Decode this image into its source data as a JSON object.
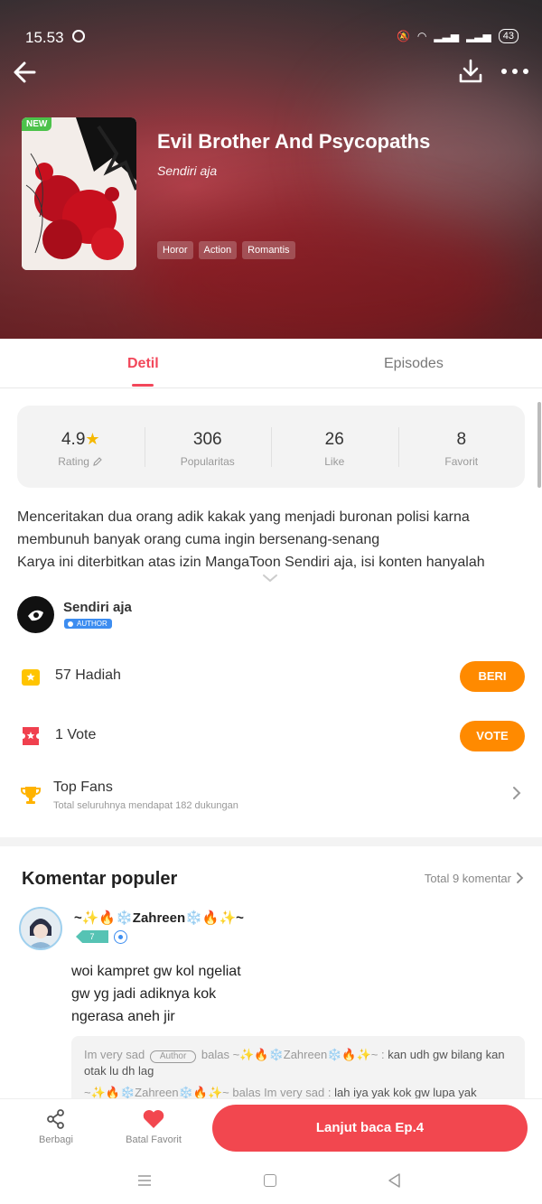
{
  "status_bar": {
    "time": "15.53",
    "battery": "43"
  },
  "manga": {
    "new_badge": "NEW",
    "title": "Evil Brother And Psycopaths",
    "author": "Sendiri aja",
    "tags": [
      "Horor",
      "Action",
      "Romantis"
    ]
  },
  "tabs": {
    "detail": "Detil",
    "episodes": "Episodes"
  },
  "stats": [
    {
      "value": "4.9",
      "label": "Rating"
    },
    {
      "value": "306",
      "label": "Popularitas"
    },
    {
      "value": "26",
      "label": "Like"
    },
    {
      "value": "8",
      "label": "Favorit"
    }
  ],
  "description": [
    "Menceritakan dua orang adik kakak yang menjadi buronan polisi karna",
    "membunuh banyak orang cuma ingin bersenang-senang",
    "Karya ini diterbitkan atas izin MangaToon Sendiri aja, isi konten hanyalah"
  ],
  "author_section": {
    "name": "Sendiri aja",
    "badge": "AUTHOR"
  },
  "gifts": {
    "label": "57 Hadiah",
    "button": "BERI"
  },
  "votes": {
    "label": "1 Vote",
    "button": "VOTE"
  },
  "top_fans": {
    "label": "Top Fans",
    "subtitle": "Total seluruhnya mendapat 182 dukungan"
  },
  "comments": {
    "title": "Komentar populer",
    "total": "Total 9 komentar",
    "items": [
      {
        "user": "~✨🔥❄️Zahreen❄️🔥✨~",
        "level": "7",
        "lines": [
          "woi kampret gw kol ngeliat",
          "gw yg jadi adiknya kok",
          "ngerasa aneh jir"
        ],
        "replies": [
          {
            "from": "Im very sad",
            "tag": "Author",
            "mid": "balas",
            "to": "~✨🔥❄️Zahreen❄️🔥✨~ :",
            "text": "kan udh gw bilang kan otak lu dh lag"
          },
          {
            "from": "~✨🔥❄️Zahreen❄️🔥✨~",
            "mid": "balas",
            "to": "Im very sad :",
            "text": "lah iya yak kok gw lupa yak"
          }
        ]
      }
    ]
  },
  "bottom_bar": {
    "share": "Berbagi",
    "favorite": "Batal Favorit",
    "continue": "Lanjut baca Ep.4"
  },
  "colors": {
    "accent": "#f2475a",
    "orange": "#ff8a00",
    "continue": "#f2474f"
  }
}
